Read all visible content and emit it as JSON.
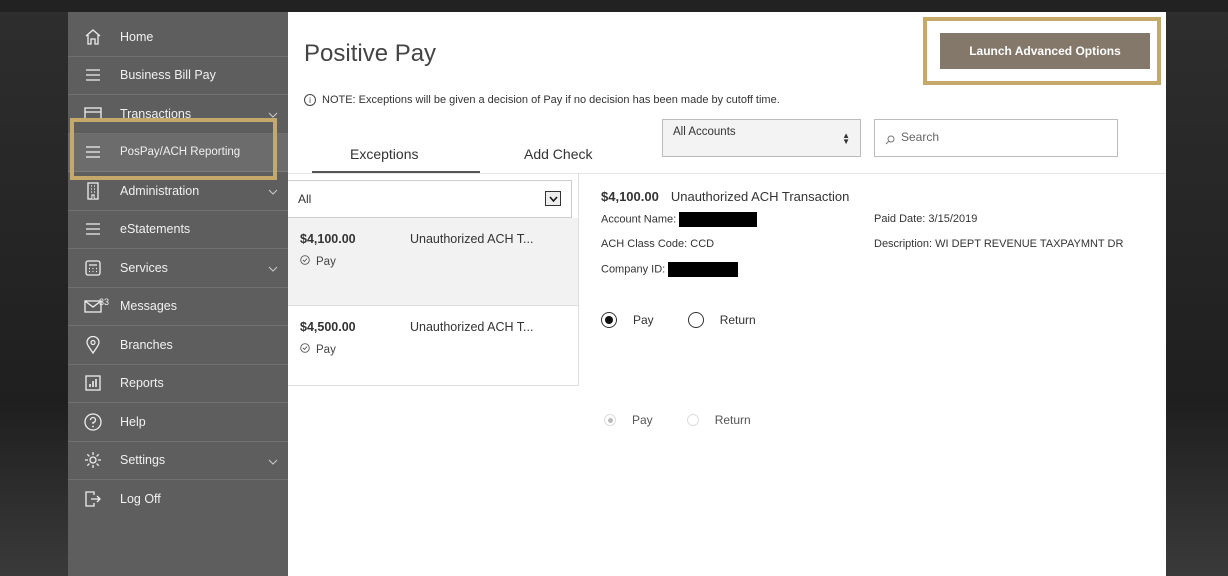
{
  "sidebar": {
    "items": [
      {
        "label": "Home",
        "icon": "home-icon"
      },
      {
        "label": "Business Bill Pay",
        "icon": "menu-icon"
      },
      {
        "label": "Transactions",
        "icon": "card-icon",
        "expandable": true
      },
      {
        "label": "PosPay/ACH Reporting",
        "icon": "menu-icon",
        "active": true
      },
      {
        "label": "Administration",
        "icon": "building-icon",
        "expandable": true
      },
      {
        "label": "eStatements",
        "icon": "menu-icon"
      },
      {
        "label": "Services",
        "icon": "calculator-icon",
        "expandable": true
      },
      {
        "label": "Messages",
        "icon": "mail-icon",
        "badge": "33"
      },
      {
        "label": "Branches",
        "icon": "location-pin-icon"
      },
      {
        "label": "Reports",
        "icon": "bar-chart-icon"
      },
      {
        "label": "Help",
        "icon": "question-icon"
      },
      {
        "label": "Settings",
        "icon": "gear-icon",
        "expandable": true
      },
      {
        "label": "Log Off",
        "icon": "logout-icon"
      }
    ]
  },
  "header": {
    "title": "Positive Pay",
    "launch_button": "Launch Advanced Options",
    "note": "NOTE: Exceptions will be given a decision of Pay if no decision has been made by cutoff time."
  },
  "tabs": [
    {
      "label": "Exceptions",
      "active": true
    },
    {
      "label": "Add Check",
      "active": false
    }
  ],
  "filters": {
    "accounts_selected": "All Accounts",
    "search_placeholder": "Search",
    "list_filter": "All"
  },
  "exceptions": [
    {
      "amount": "$4,100.00",
      "description": "Unauthorized ACH T...",
      "decision": "Pay",
      "selected": true
    },
    {
      "amount": "$4,500.00",
      "description": "Unauthorized ACH T...",
      "decision": "Pay",
      "selected": false
    }
  ],
  "detail": {
    "amount": "$4,100.00",
    "title": "Unauthorized ACH Transaction",
    "account_name_label": "Account Name:",
    "ach_class_code": "ACH Class Code: CCD",
    "company_id_label": "Company ID:",
    "paid_date": "Paid Date: 3/15/2019",
    "description": "Description: WI DEPT REVENUE TAXPAYMNT DR"
  },
  "decision": {
    "pay_label": "Pay",
    "return_label": "Return",
    "selected": "Pay"
  },
  "colors": {
    "sidebar_bg": "#5e5e5e",
    "highlight": "#c5a96a",
    "launch_button": "#84786a"
  }
}
